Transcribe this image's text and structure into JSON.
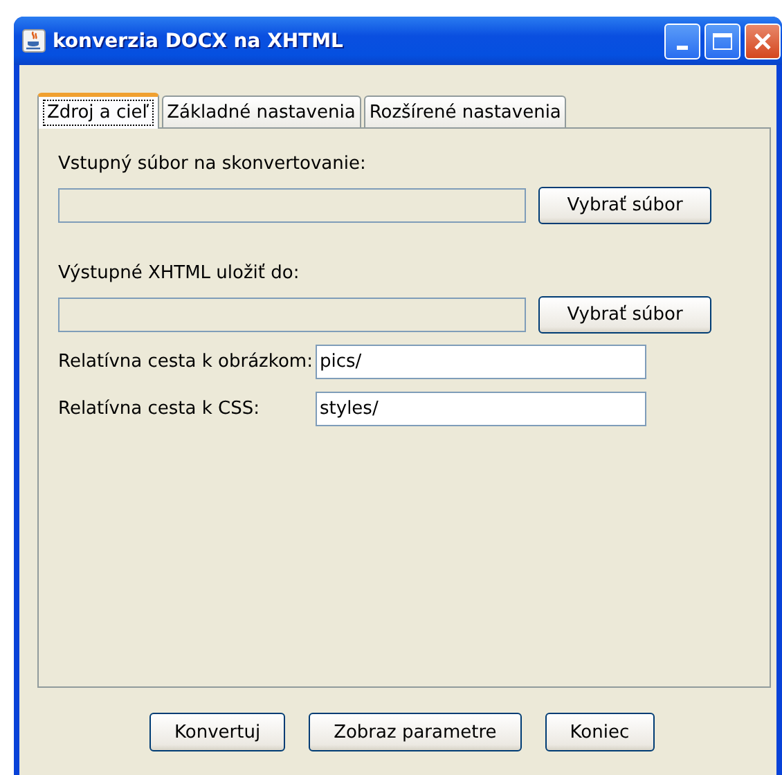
{
  "window": {
    "title": "konverzia DOCX na XHTML"
  },
  "tabs": [
    {
      "label": "Zdroj a cieľ",
      "selected": true
    },
    {
      "label": "Základné nastavenia",
      "selected": false
    },
    {
      "label": "Rozšírené nastavenia",
      "selected": false
    }
  ],
  "file_sections": [
    {
      "label": "Vstupný súbor na skonvertovanie:",
      "button": "Vybrať súbor"
    },
    {
      "label": "Výstupné XHTML uložiť do:",
      "button": "Vybrať súbor"
    }
  ],
  "path_fields": [
    {
      "label": "Relatívna cesta k obrázkom:",
      "value": "pics/"
    },
    {
      "label": "Relatívna cesta k CSS:",
      "value": "styles/"
    }
  ],
  "buttons": [
    "Konvertuj",
    "Zobraz parametre",
    "Koniec"
  ]
}
